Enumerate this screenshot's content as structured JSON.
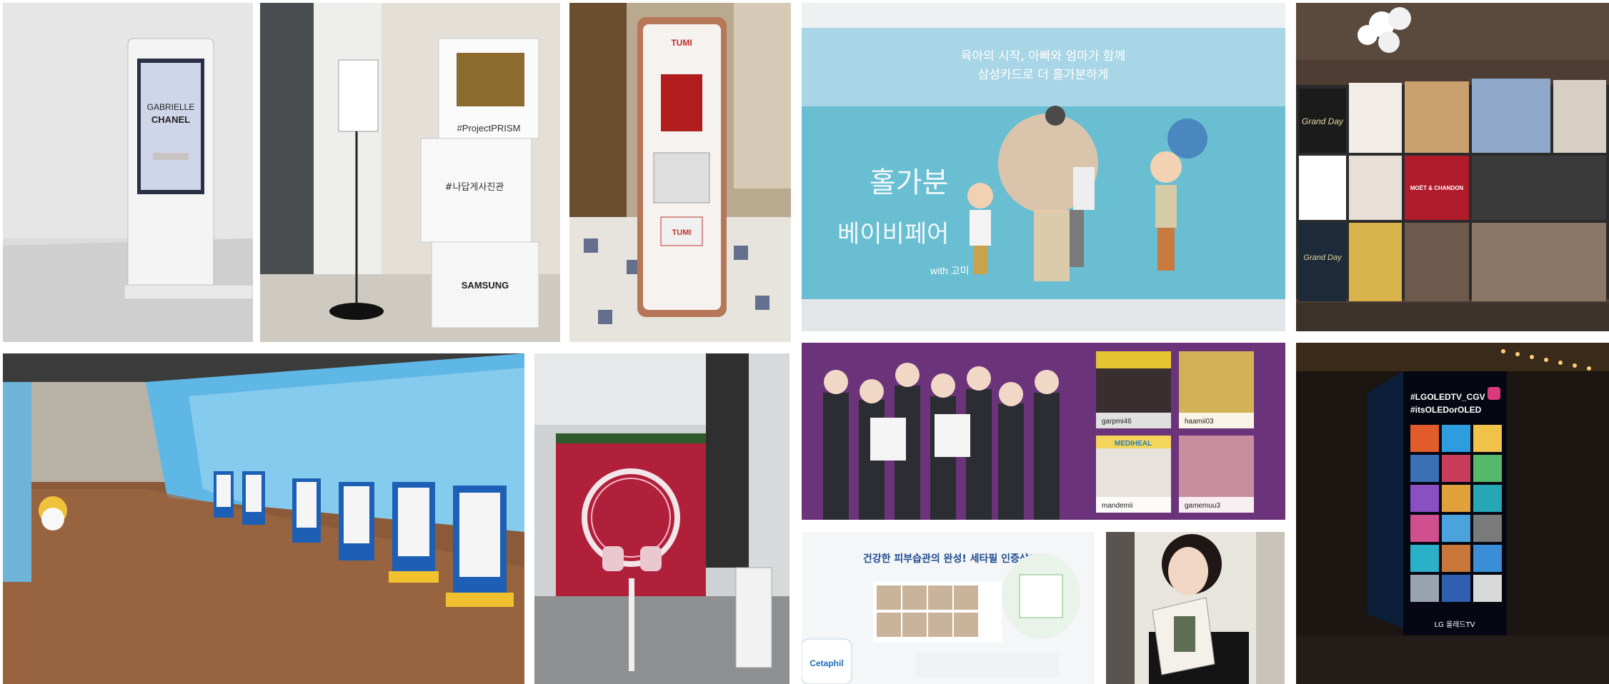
{
  "photos": {
    "chanel_kiosk": {
      "screen_line1": "GABRIELLE",
      "screen_line2": "CHANEL"
    },
    "samsung_prism": {
      "cube_top": "#ProjectPRISM",
      "cube_mid": "#나답게사진관",
      "cube_bottom": "SAMSUNG"
    },
    "tumi_kiosk": {
      "brand_top": "TUMI",
      "brand_panel": "TUMI"
    },
    "samsung_card_mosaic": {
      "headline1": "육아의 시작, 아빠와 엄마가 함께",
      "headline2": "삼성카드로 더 홀가분하게",
      "script_line1": "홀가분",
      "script_line2": "베이비페어",
      "script_line3": "with 고미"
    },
    "moet_wall": {
      "card1": "Grand Day",
      "card2": "MOËT & CHANDON",
      "card3": "Grand Day"
    },
    "kpop_mediheal": {
      "handles": [
        "garpmi46",
        "haamii03",
        "mandemii",
        "gamemuu3"
      ],
      "store_sign": "MEDIHEAL"
    },
    "cetaphil_ad": {
      "headline": "건강한 피부습관의 완성! 세타필 인증샷!",
      "bottle_brand": "Cetaphil"
    },
    "lg_oled_tower": {
      "tag_line1": "#LGOLEDTV_CGV",
      "tag_line2": "#itsOLEDorOLED",
      "footer": "LG 올레드TV"
    }
  }
}
